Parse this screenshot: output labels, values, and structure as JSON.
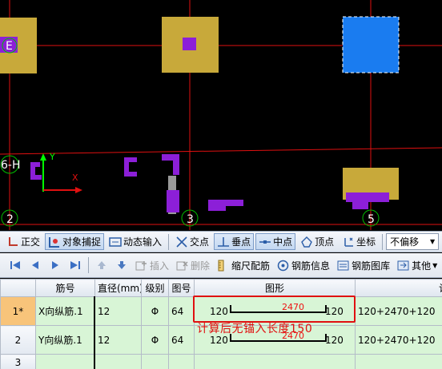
{
  "canvas": {
    "grid_labels": [
      "E",
      "6-H",
      "2",
      "3",
      "5"
    ],
    "axis_y_label": "Y",
    "axis_x_label": "X"
  },
  "snapbar": {
    "ortho": "正交",
    "object_snap": "对象捕捉",
    "dynamic_input": "动态输入",
    "intersection": "交点",
    "perpendicular": "垂点",
    "midpoint": "中点",
    "vertex": "顶点",
    "coordinate": "坐标",
    "offset_select": "不偏移"
  },
  "toolbar": {
    "insert": "插入",
    "delete": "删除",
    "ruler_rebar": "缩尺配筋",
    "rebar_info": "钢筋信息",
    "rebar_library": "钢筋图库",
    "other": "其他"
  },
  "table": {
    "headers": [
      "",
      "筋号",
      "直径(mm)",
      "级别",
      "图号",
      "图形",
      "计算公式"
    ],
    "rows": [
      {
        "num": "1*",
        "name": "X向纵筋.1",
        "dia": "12",
        "grade": "Φ",
        "fig": "64",
        "shape_left": "120",
        "shape_mid": "2470",
        "shape_right": "120",
        "formula": "120+2470+120"
      },
      {
        "num": "2",
        "name": "Y向纵筋.1",
        "dia": "12",
        "grade": "Φ",
        "fig": "64",
        "shape_left": "120",
        "shape_mid": "2470",
        "shape_right": "120",
        "formula": "120+2470+120"
      },
      {
        "num": "3",
        "name": "",
        "dia": "",
        "grade": "",
        "fig": "",
        "shape_left": "",
        "shape_mid": "",
        "shape_right": "",
        "formula": ""
      }
    ]
  },
  "annotation": "计算后无锚入长度150",
  "colors": {
    "column": "#c8a93a",
    "selected_column": "#1a7cf0",
    "rebar": "#8c1fd8",
    "grid_line": "#e01010",
    "annotation": "#e01010"
  }
}
